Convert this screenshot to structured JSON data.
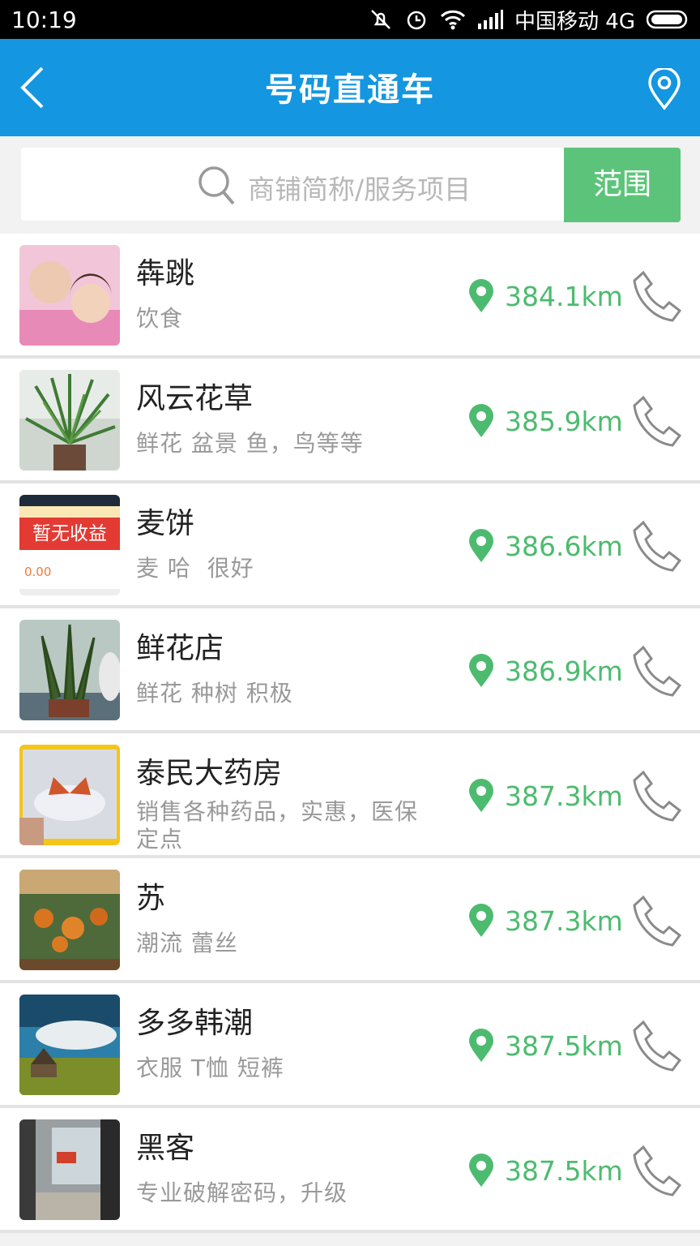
{
  "status_bar": {
    "time": "10:19",
    "carrier": "中国移动 4G"
  },
  "app_bar": {
    "title": "号码直通车"
  },
  "search": {
    "placeholder": "商铺简称/服务项目",
    "range_button": "范围"
  },
  "stores": [
    {
      "name": "犇跳",
      "desc": "饮食",
      "distance": "384.1km"
    },
    {
      "name": "风云花草",
      "desc": "鲜花 盆景 鱼，鸟等等",
      "distance": "385.9km"
    },
    {
      "name": "麦饼",
      "desc": "麦 哈  很好",
      "distance": "386.6km",
      "thumb_text": "暂无收益",
      "thumb_value": "0.00"
    },
    {
      "name": "鲜花店",
      "desc": "鲜花 种树 积极",
      "distance": "386.9km"
    },
    {
      "name": "泰民大药房",
      "desc": "销售各种药品，实惠，医保定点",
      "distance": "387.3km"
    },
    {
      "name": "苏",
      "desc": "潮流 蕾丝",
      "distance": "387.3km"
    },
    {
      "name": "多多韩潮",
      "desc": "衣服 T恤 短裤",
      "distance": "387.5km"
    },
    {
      "name": "黑客",
      "desc": "专业破解密码，升级",
      "distance": "387.5km"
    }
  ],
  "colors": {
    "app_bar": "#1496e0",
    "accent_green": "#5cc47a",
    "distance_green": "#4dbb6f"
  }
}
